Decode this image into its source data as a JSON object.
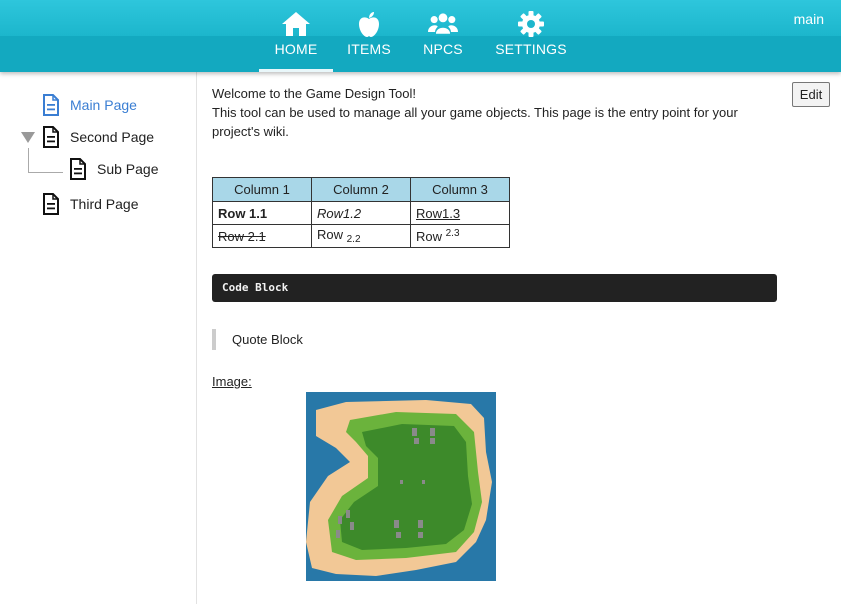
{
  "header": {
    "user": "main",
    "nav": [
      {
        "label": "HOME",
        "icon": "home-icon",
        "active": true
      },
      {
        "label": "ITEMS",
        "icon": "apple-icon",
        "active": false
      },
      {
        "label": "NPCS",
        "icon": "people-icon",
        "active": false
      },
      {
        "label": "SETTINGS",
        "icon": "gear-icon",
        "active": false
      }
    ]
  },
  "sidebar": {
    "items": [
      {
        "label": "Main Page",
        "icon": "document-icon",
        "selected": true
      },
      {
        "label": "Second Page",
        "icon": "document-icon",
        "expanded": true
      },
      {
        "label": "Sub Page",
        "icon": "document-icon"
      },
      {
        "label": "Third Page",
        "icon": "document-icon"
      }
    ]
  },
  "content": {
    "edit_label": "Edit",
    "intro_line1": "Welcome to the Game Design Tool!",
    "intro_line2": "This tool can be used to manage all your game objects. This page is the entry point for your project's wiki.",
    "table": {
      "headers": [
        "Column 1",
        "Column 2",
        "Column 3"
      ],
      "rows": [
        {
          "c1": "Row 1.1",
          "c2": "Row1.2",
          "c3": "Row1.3"
        },
        {
          "c1": "Row 2.1",
          "c2_base": "Row ",
          "c2_sub": "2.2",
          "c3_base": "Row ",
          "c3_sup": "2.3"
        }
      ]
    },
    "code_block": "Code Block",
    "quote_block": "Quote Block",
    "image_label": "Image:"
  },
  "colors": {
    "header": "#1cb6cc",
    "accent_link": "#3a7ed3",
    "table_header": "#a9d7e8",
    "code_bg": "#222222"
  }
}
